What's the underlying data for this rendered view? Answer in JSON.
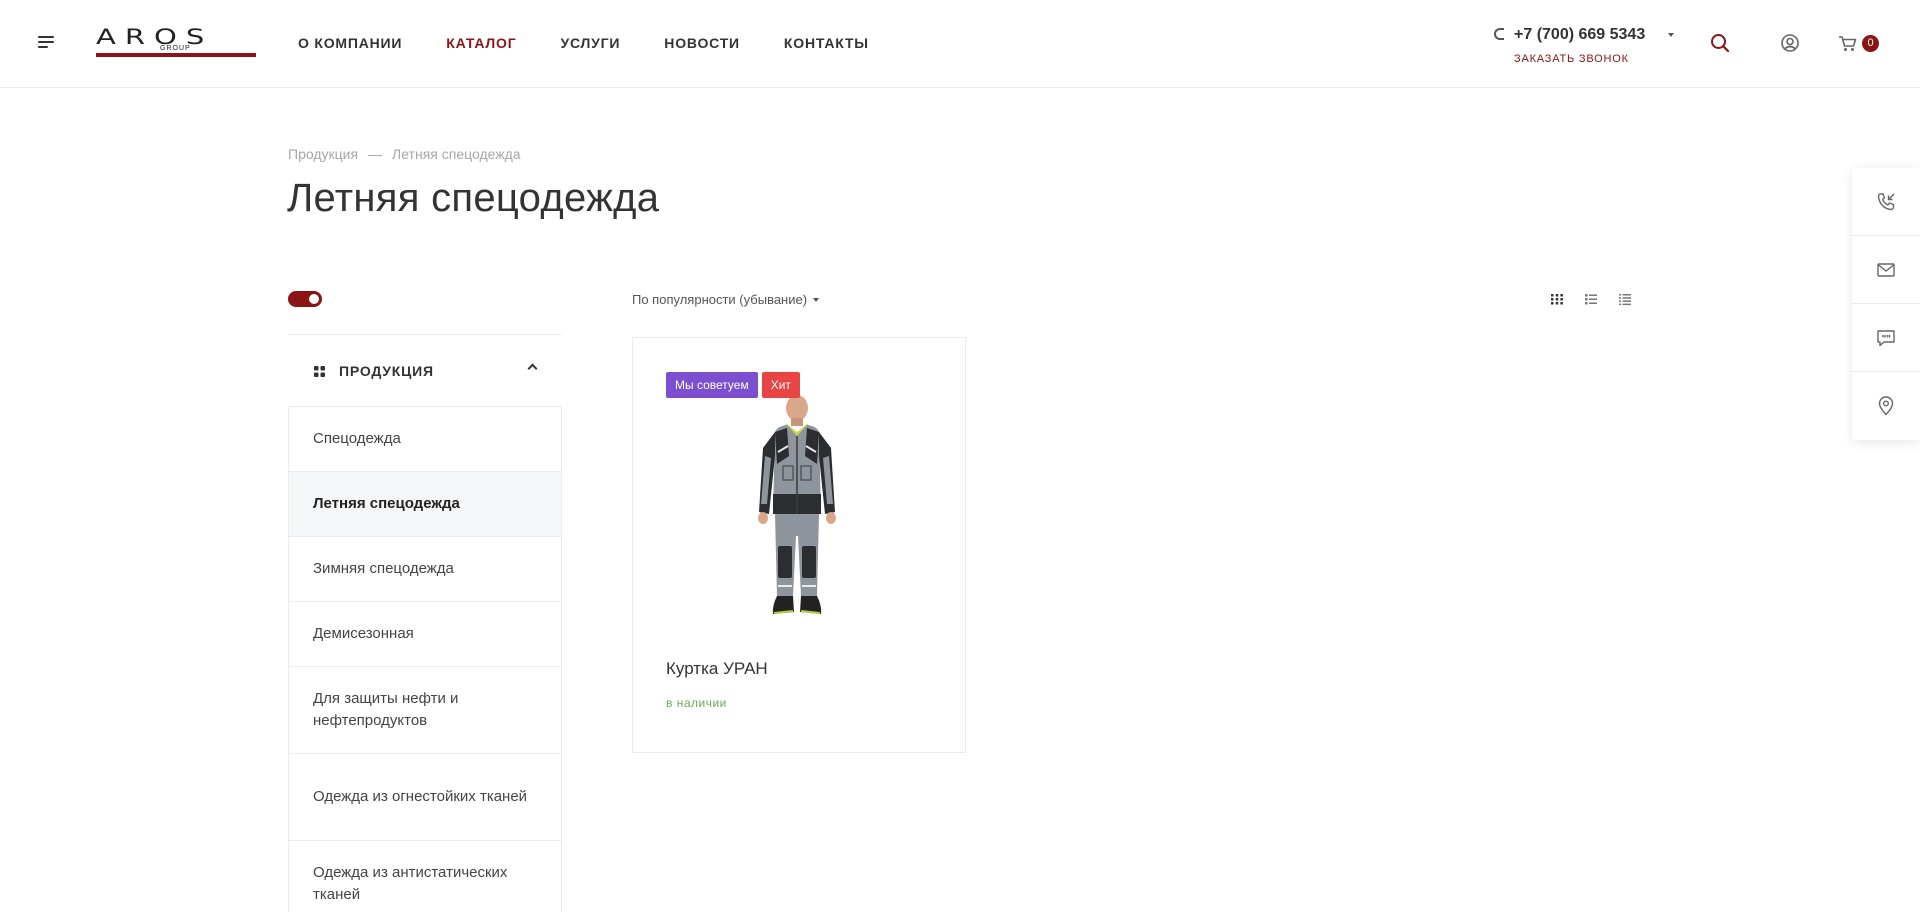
{
  "colors": {
    "accent": "#8b1414",
    "recommend": "#7c4fd1",
    "hit": "#e84444",
    "in_stock": "#6ea85a"
  },
  "header": {
    "logo": {
      "main": "AROS",
      "sub": "GROUP"
    },
    "nav": [
      {
        "label": "О КОМПАНИИ",
        "active": false
      },
      {
        "label": "КАТАЛОГ",
        "active": true
      },
      {
        "label": "УСЛУГИ",
        "active": false
      },
      {
        "label": "НОВОСТИ",
        "active": false
      },
      {
        "label": "КОНТАКТЫ",
        "active": false
      }
    ],
    "phone": "+7 (700) 669 5343",
    "callback_label": "ЗАКАЗАТЬ ЗВОНОК",
    "cart_count": "0",
    "icons": [
      "menu-icon",
      "phone-icon",
      "search-icon",
      "user-icon",
      "cart-icon"
    ]
  },
  "side_panel": {
    "icons": [
      "callback-icon",
      "mail-icon",
      "chat-icon",
      "location-icon"
    ]
  },
  "breadcrumb": {
    "items": [
      "Продукция",
      "Летняя спецодежда"
    ],
    "separator": "—"
  },
  "page_title": "Летняя спецодежда",
  "filter_toggle": {
    "on": true
  },
  "sort": {
    "label": "По популярности (убывание)"
  },
  "view_modes": [
    "grid-view-icon",
    "list-view-icon",
    "table-view-icon"
  ],
  "sidebar": {
    "title": "ПРОДУКЦИЯ",
    "items": [
      {
        "label": "Спецодежда",
        "active": false
      },
      {
        "label": "Летняя спецодежда",
        "active": true
      },
      {
        "label": "Зимняя спецодежда",
        "active": false
      },
      {
        "label": "Демисезонная",
        "active": false
      },
      {
        "label": "Для защиты нефти и нефтепродуктов",
        "active": false
      },
      {
        "label": "Одежда из огнестойких тканей",
        "active": false
      },
      {
        "label": "Одежда из антистатических тканей",
        "active": false
      }
    ]
  },
  "products": [
    {
      "name": "Куртка УРАН",
      "stock": "в наличии",
      "stickers": [
        "Мы советуем",
        "Хит"
      ]
    }
  ]
}
